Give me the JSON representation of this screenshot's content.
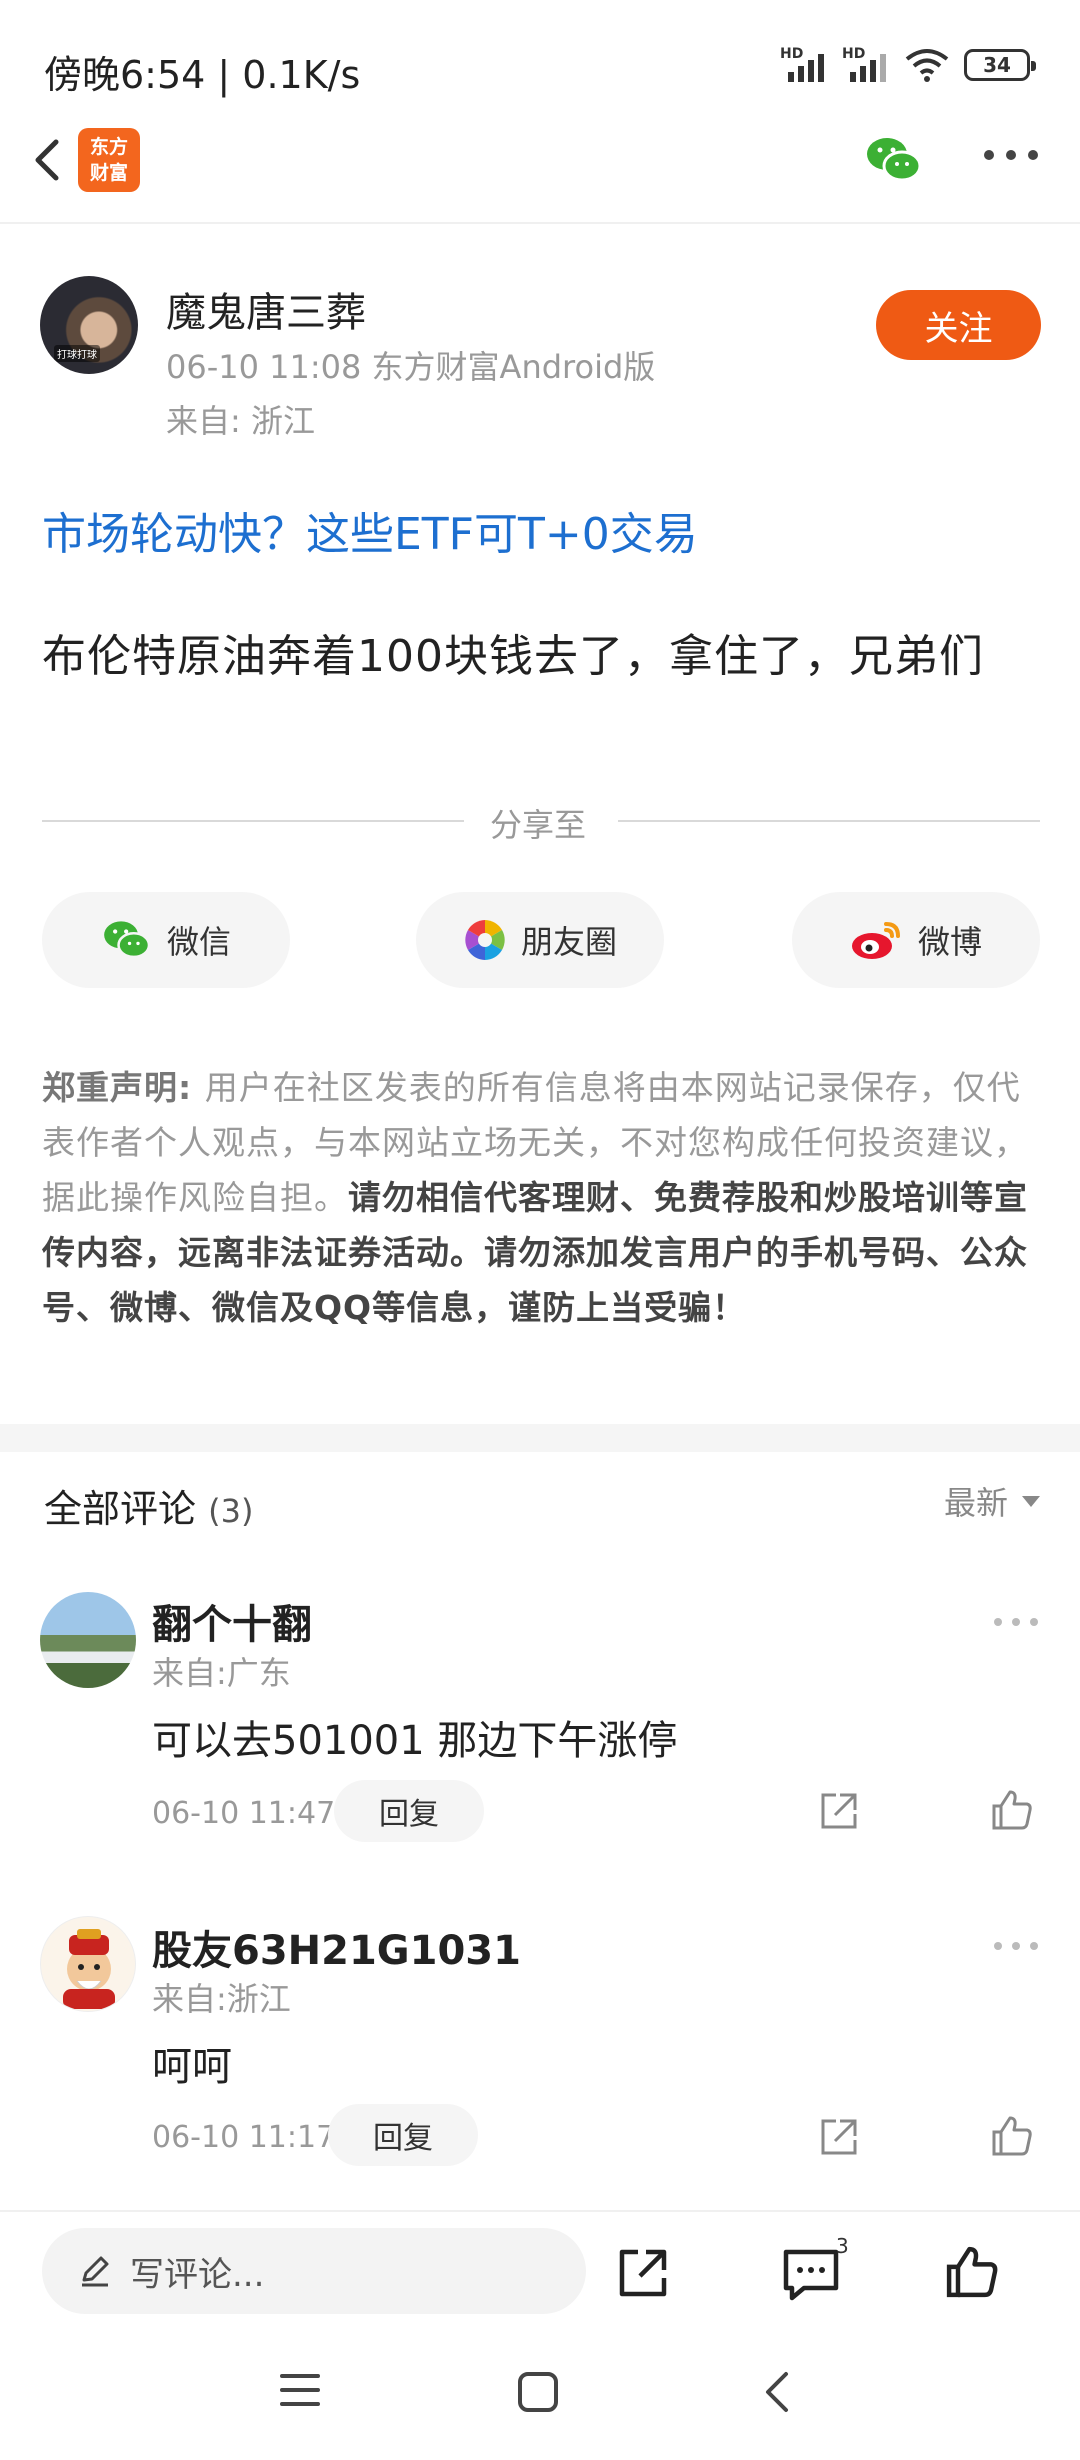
{
  "status_bar": {
    "time": "傍晚6:54 | 0.1K/s",
    "battery": "34"
  },
  "header": {
    "logo_line1": "东方",
    "logo_line2": "财富"
  },
  "post": {
    "author": "魔鬼唐三葬",
    "meta": "06-10 11:08 东方财富Android版",
    "location": "来自: 浙江",
    "follow_label": "关注",
    "ad_link": "市场轮动快？这些ETF可T+0交易",
    "body": "布伦特原油奔着100块钱去了，拿住了，兄弟们"
  },
  "share": {
    "label": "分享至",
    "wechat": "微信",
    "moments": "朋友圈",
    "weibo": "微博"
  },
  "disclaimer": {
    "lead": "郑重声明: ",
    "normal": "用户在社区发表的所有信息将由本网站记录保存，仅代表作者个人观点，与本网站立场无关，不对您构成任何投资建议，据此操作风险自担。",
    "strong": "请勿相信代客理财、免费荐股和炒股培训等宣传内容，远离非法证券活动。请勿添加发言用户的手机号码、公众号、微博、微信及QQ等信息，谨防上当受骗！"
  },
  "comments": {
    "title": "全部评论",
    "count": "(3)",
    "sort": "最新",
    "items": [
      {
        "name": "翻个十翻",
        "location": "来自:广东",
        "text": "可以去501001 那边下午涨停",
        "time": "06-10 11:47",
        "reply": "回复"
      },
      {
        "name": "股友63H21G1031",
        "location": "来自:浙江",
        "text": "呵呵",
        "time": "06-10 11:17",
        "reply": "回复"
      }
    ]
  },
  "bottom": {
    "input_placeholder": "写评论...",
    "comment_badge": "3"
  }
}
